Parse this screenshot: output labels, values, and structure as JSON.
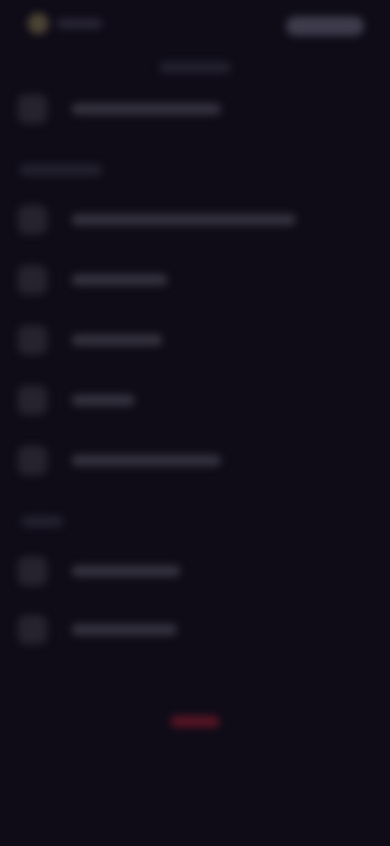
{
  "header": {
    "brand_label": "",
    "menu_button_label": ""
  },
  "sections": [
    {
      "title": "",
      "items": [
        {
          "label": "",
          "icon": "user-icon"
        }
      ]
    },
    {
      "title": "",
      "items": [
        {
          "label": "",
          "icon": "settings-icon"
        },
        {
          "label": "",
          "icon": "bell-icon"
        },
        {
          "label": "",
          "icon": "lock-icon"
        },
        {
          "label": "",
          "icon": "globe-icon"
        },
        {
          "label": "",
          "icon": "wallet-icon"
        }
      ]
    },
    {
      "title": "",
      "items": [
        {
          "label": "",
          "icon": "help-icon"
        },
        {
          "label": "",
          "icon": "info-icon"
        }
      ]
    }
  ],
  "footer": {
    "logout_label": ""
  },
  "colors": {
    "background": "#0f0c18",
    "logout_accent": "#5a1524",
    "brand_mark": "#4b4534"
  }
}
